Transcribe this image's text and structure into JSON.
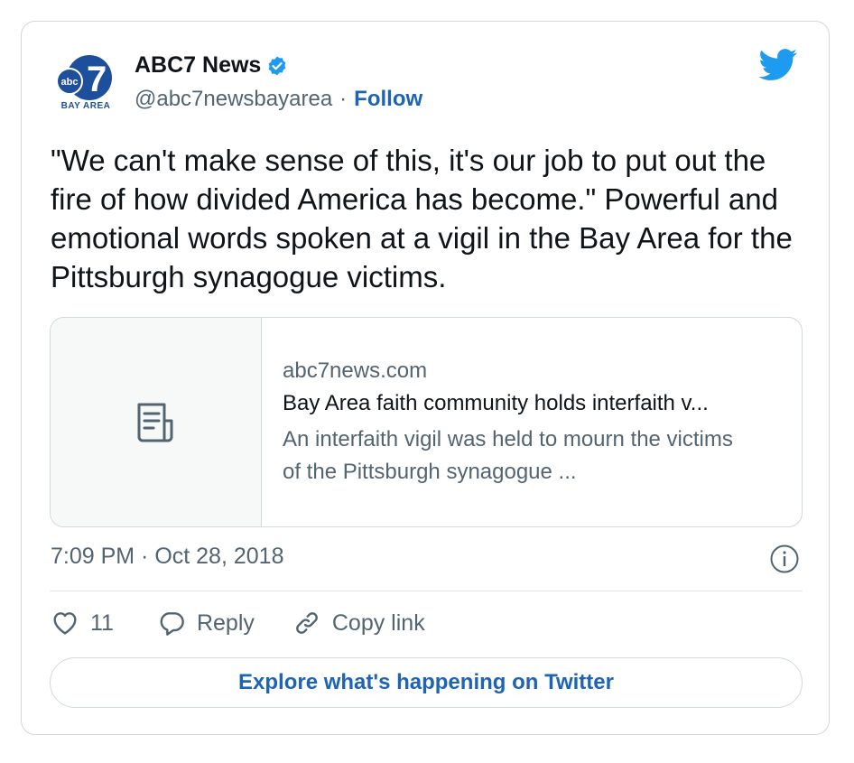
{
  "account": {
    "name": "ABC7 News",
    "handle": "@abc7newsbayarea",
    "separator": "·",
    "follow_label": "Follow",
    "logo_text": "abc",
    "logo_number": "7",
    "logo_subtitle": "BAY AREA"
  },
  "tweet": {
    "text": "\"We can't make sense of this, it's our job to put out the fire of how divided America has become.\" Powerful and emotional words spoken at a vigil in the Bay Area for the Pittsburgh synagogue victims.",
    "timestamp": "7:09 PM · Oct 28, 2018"
  },
  "link_card": {
    "domain": "abc7news.com",
    "title": "Bay Area faith community holds interfaith v...",
    "description": "An interfaith vigil was held to mourn the victims of the Pittsburgh synagogue ...",
    "thumbnail_icon": "article-icon"
  },
  "actions": {
    "like_count": "11",
    "reply_label": "Reply",
    "copy_link_label": "Copy link"
  },
  "explore_label": "Explore what's happening on Twitter",
  "colors": {
    "accent": "#1d64b7",
    "twitter_blue": "#1d9bf0",
    "text": "#0f1419",
    "muted": "#536471",
    "border": "#cfd9de"
  }
}
